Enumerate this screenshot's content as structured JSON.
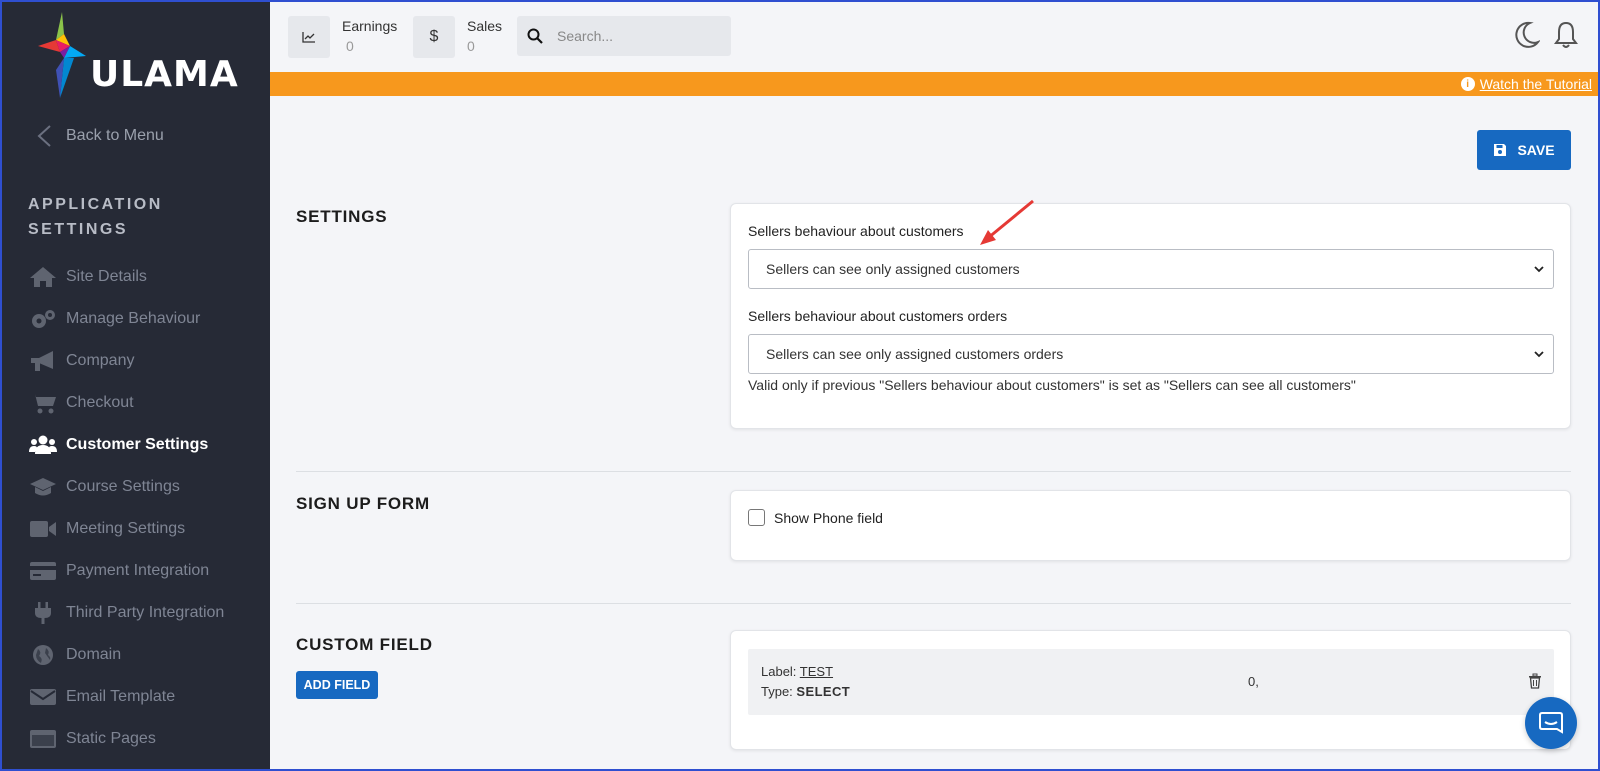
{
  "app": {
    "brand": "ULAMA"
  },
  "sidebar": {
    "back_label": "Back to Menu",
    "section_title": "APPLICATION SETTINGS",
    "items": [
      {
        "label": "Site Details",
        "icon": "home-icon"
      },
      {
        "label": "Manage Behaviour",
        "icon": "gears-icon"
      },
      {
        "label": "Company",
        "icon": "megaphone-icon"
      },
      {
        "label": "Checkout",
        "icon": "cart-icon"
      },
      {
        "label": "Customer Settings",
        "icon": "users-icon",
        "active": true
      },
      {
        "label": "Course Settings",
        "icon": "graduation-cap-icon"
      },
      {
        "label": "Meeting Settings",
        "icon": "video-icon"
      },
      {
        "label": "Payment Integration",
        "icon": "credit-card-icon"
      },
      {
        "label": "Third Party Integration",
        "icon": "plug-icon"
      },
      {
        "label": "Domain",
        "icon": "globe-icon"
      },
      {
        "label": "Email Template",
        "icon": "envelope-icon"
      },
      {
        "label": "Static Pages",
        "icon": "window-icon"
      }
    ]
  },
  "topbar": {
    "earnings_label": "Earnings",
    "earnings_value": "0",
    "sales_label": "Sales",
    "sales_value": "0",
    "sales_icon_glyph": "$",
    "search_placeholder": "Search..."
  },
  "banner": {
    "tutorial_label": "Watch the Tutorial",
    "info_glyph": "i"
  },
  "toolbar": {
    "save_label": "SAVE"
  },
  "settings": {
    "heading": "SETTINGS",
    "customers_label": "Sellers behaviour about customers",
    "customers_value": "Sellers can see only assigned customers",
    "orders_label": "Sellers behaviour about customers orders",
    "orders_value": "Sellers can see only assigned customers orders",
    "help_text": "Valid only if previous \"Sellers behaviour about customers\" is set as \"Sellers can see all customers\""
  },
  "signup": {
    "heading": "SIGN UP FORM",
    "show_phone_label": "Show Phone field",
    "show_phone_checked": false
  },
  "custom_field": {
    "heading": "CUSTOM FIELD",
    "add_label": "ADD FIELD",
    "label_prefix": "Label: ",
    "label_value": "TEST",
    "type_prefix": "Type: ",
    "type_value": "SELECT",
    "options": "0,"
  },
  "colors": {
    "sidebar_bg": "#262a36",
    "accent": "#1769c1",
    "banner": "#f7981d",
    "annotation_arrow": "#e53935"
  }
}
